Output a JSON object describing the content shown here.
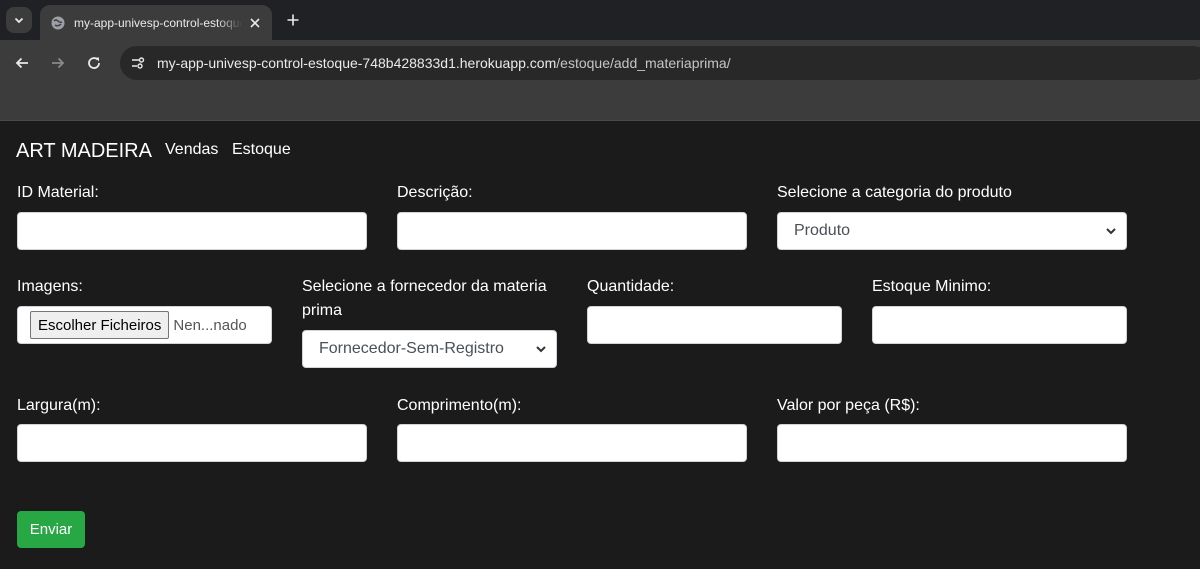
{
  "browser": {
    "tab_title": "my-app-univesp-control-estoque-748b428833d1",
    "url_host": "my-app-univesp-control-estoque-748b428833d1.herokuapp.com",
    "url_path": "/estoque/add_materiaprima/"
  },
  "navbar": {
    "brand": "ART MADEIRA",
    "links": [
      "Vendas",
      "Estoque"
    ]
  },
  "form": {
    "id_material_label": "ID Material:",
    "descricao_label": "Descrição:",
    "categoria_label": "Selecione a categoria do produto",
    "categoria_value": "Produto",
    "imagens_label": "Imagens:",
    "file_button": "Escolher Ficheiros",
    "file_status": "Nen...nado",
    "fornecedor_label_line1": "Selecione a fornecedor da materia",
    "fornecedor_label_line2": "prima",
    "fornecedor_value": "Fornecedor-Sem-Registro",
    "quantidade_label": "Quantidade:",
    "estoque_minimo_label": "Estoque Minimo:",
    "largura_label": "Largura(m):",
    "comprimento_label": "Comprimento(m):",
    "valor_label": "Valor por peça (R$):",
    "submit_label": "Enviar"
  },
  "colors": {
    "page_bg": "#1b1b1b",
    "submit_bg": "#28a745",
    "browser_chrome": "#3c3c3c"
  }
}
